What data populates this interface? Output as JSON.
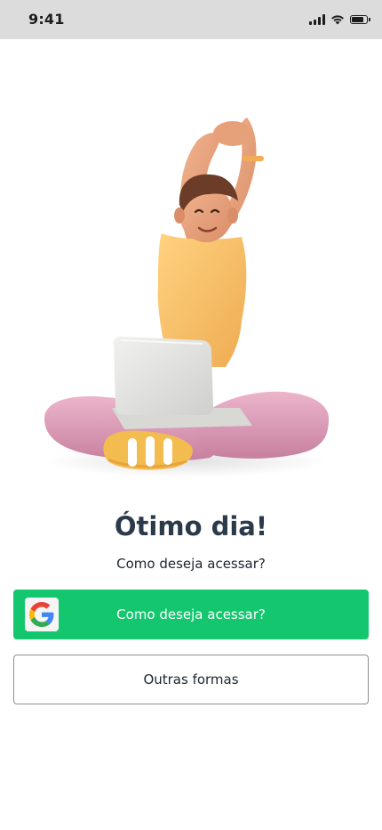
{
  "status_bar": {
    "time": "9:41",
    "icons": [
      "signal-icon",
      "wifi-icon",
      "battery-icon"
    ],
    "battery_level": 0.85
  },
  "illustration": {
    "subject": "person-stretching-with-laptop-icon"
  },
  "content": {
    "title": "Ótimo dia!",
    "subtitle": "Como deseja acessar?"
  },
  "actions": {
    "google_button_label": "Como deseja acessar?",
    "google_icon": "google-icon",
    "other_button_label": "Outras formas"
  },
  "colors": {
    "primary_green": "#14c76e",
    "title_text": "#2b3a4a",
    "status_bar_bg": "#dcdcdc",
    "border_gray": "#8e8e8e"
  }
}
